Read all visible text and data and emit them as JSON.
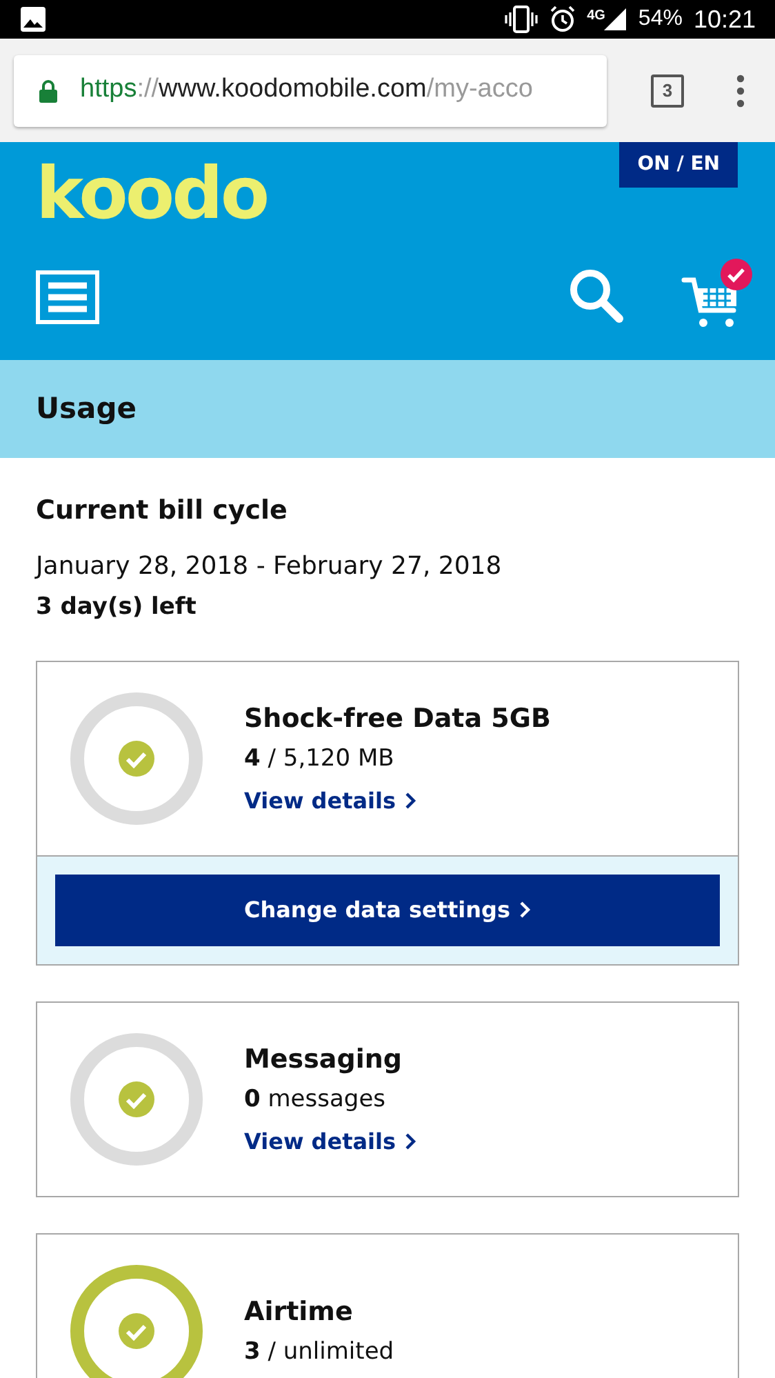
{
  "status_bar": {
    "network": "4G",
    "battery": "54%",
    "time": "10:21"
  },
  "browser": {
    "url": {
      "scheme": "https",
      "separator": "://",
      "host": "www.koodomobile.com",
      "path": "/my-acco"
    },
    "tab_count": "3"
  },
  "header": {
    "logo": "koodo",
    "language": "ON / EN",
    "cart_has_item": true
  },
  "page_title": "Usage",
  "bill_cycle": {
    "title": "Current bill cycle",
    "dates": "January 28, 2018 - February 27, 2018",
    "remaining": "3 day(s) left"
  },
  "usage": [
    {
      "title": "Shock-free Data 5GB",
      "amount": "**4** / 5,120 MB",
      "kind": "metered",
      "link": "View details",
      "button": "Change data settings"
    },
    {
      "title": "Messaging",
      "amount": "**0** messages",
      "kind": "metered",
      "link": "View details"
    },
    {
      "title": "Airtime",
      "amount": "**3** / unlimited",
      "kind": "unlimited"
    }
  ]
}
